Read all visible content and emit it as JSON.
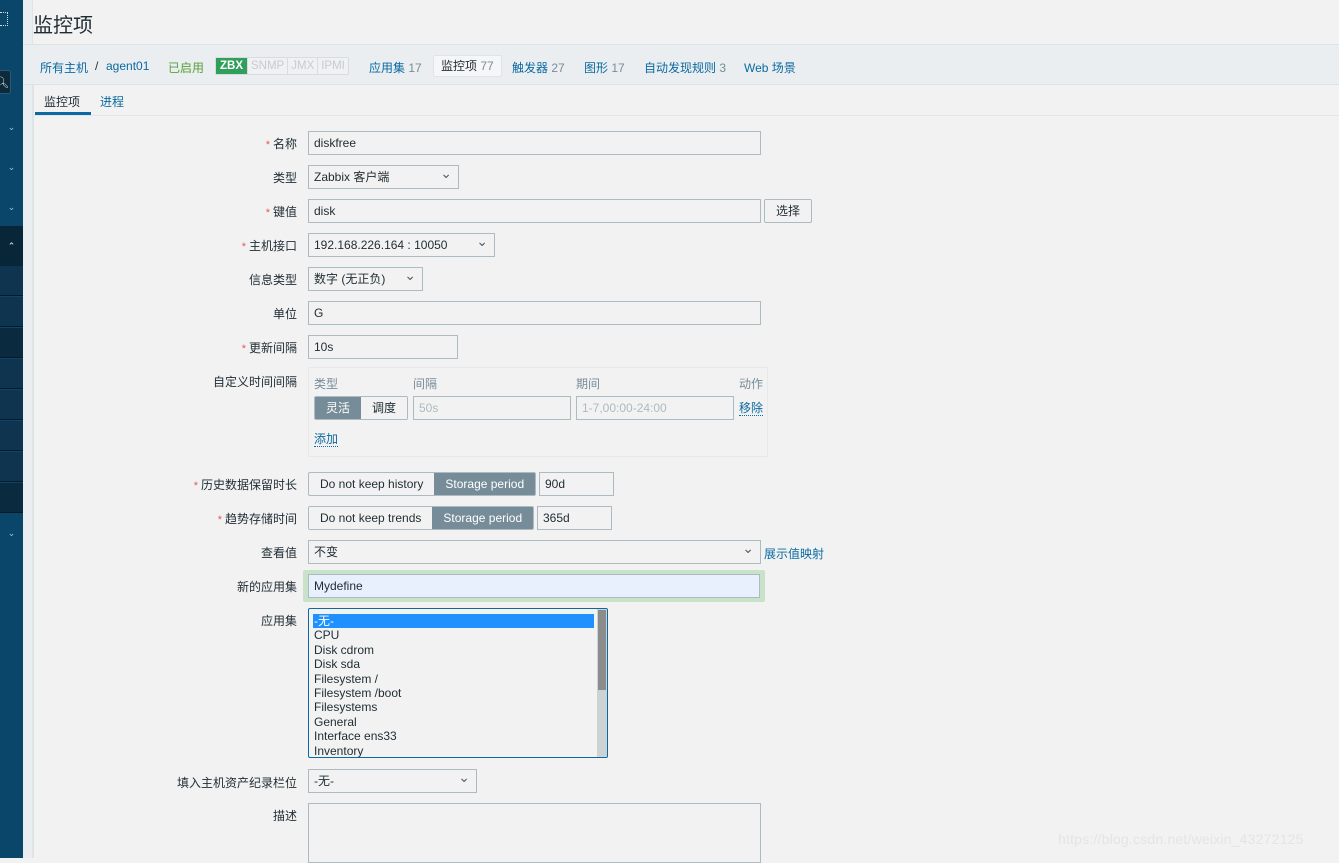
{
  "page": {
    "title": "监控项"
  },
  "sidebar": {
    "items": [
      {
        "icon": "chevron-down-icon",
        "glyph": "⌄"
      },
      {
        "icon": "chevron-down-icon",
        "glyph": "⌄"
      },
      {
        "icon": "chevron-down-icon",
        "glyph": "⌄"
      },
      {
        "icon": "chevron-up-icon",
        "glyph": "⌃"
      },
      {
        "icon": "chevron-down-icon",
        "glyph": "⌄"
      }
    ],
    "search_glyph": "🔍︎"
  },
  "hostbar": {
    "all_hosts": "所有主机",
    "separator": "/",
    "host": "agent01",
    "status": "已启用",
    "availability": [
      "ZBX",
      "SNMP",
      "JMX",
      "IPMI"
    ],
    "links": [
      {
        "label": "应用集",
        "count": "17"
      },
      {
        "label": "监控项",
        "count": "77",
        "selected": true
      },
      {
        "label": "触发器",
        "count": "27"
      },
      {
        "label": "图形",
        "count": "17"
      },
      {
        "label": "自动发现规则",
        "count": "3"
      },
      {
        "label": "Web 场景",
        "count": ""
      }
    ]
  },
  "tabs": [
    {
      "label": "监控项",
      "active": true
    },
    {
      "label": "进程",
      "active": false
    }
  ],
  "form": {
    "required_mark": "*",
    "name": {
      "label": "名称",
      "value": "diskfree"
    },
    "type": {
      "label": "类型",
      "value": "Zabbix 客户端"
    },
    "key": {
      "label": "键值",
      "value": "disk",
      "button": "选择"
    },
    "interface": {
      "label": "主机接口",
      "value": "192.168.226.164 : 10050"
    },
    "info_type": {
      "label": "信息类型",
      "value": "数字 (无正负)"
    },
    "units": {
      "label": "单位",
      "value": "G"
    },
    "update_interval": {
      "label": "更新间隔",
      "value": "10s"
    },
    "custom_intervals": {
      "label": "自定义时间间隔",
      "headers": {
        "type": "类型",
        "interval": "间隔",
        "period": "期间",
        "action": "动作"
      },
      "row": {
        "type_options": [
          "灵活",
          "调度"
        ],
        "type_selected": "灵活",
        "interval_placeholder": "50s",
        "period_placeholder": "1-7,00:00-24:00",
        "remove": "移除"
      },
      "add": "添加"
    },
    "history": {
      "label": "历史数据保留时长",
      "options": [
        "Do not keep history",
        "Storage period"
      ],
      "selected": "Storage period",
      "value": "90d"
    },
    "trends": {
      "label": "趋势存储时间",
      "options": [
        "Do not keep trends",
        "Storage period"
      ],
      "selected": "Storage period",
      "value": "365d"
    },
    "show_value": {
      "label": "查看值",
      "value": "不变",
      "link": "展示值映射"
    },
    "new_application": {
      "label": "新的应用集",
      "value": "Mydefine"
    },
    "applications": {
      "label": "应用集",
      "options": [
        "-无-",
        "CPU",
        "Disk cdrom",
        "Disk sda",
        "Filesystem /",
        "Filesystem /boot",
        "Filesystems",
        "General",
        "Interface ens33",
        "Inventory"
      ],
      "selected": "-无-"
    },
    "inventory_field": {
      "label": "填入主机资产纪录栏位",
      "value": "-无-"
    },
    "description": {
      "label": "描述",
      "value": ""
    }
  },
  "watermark": "https://blog.csdn.net/weixin_43272125"
}
